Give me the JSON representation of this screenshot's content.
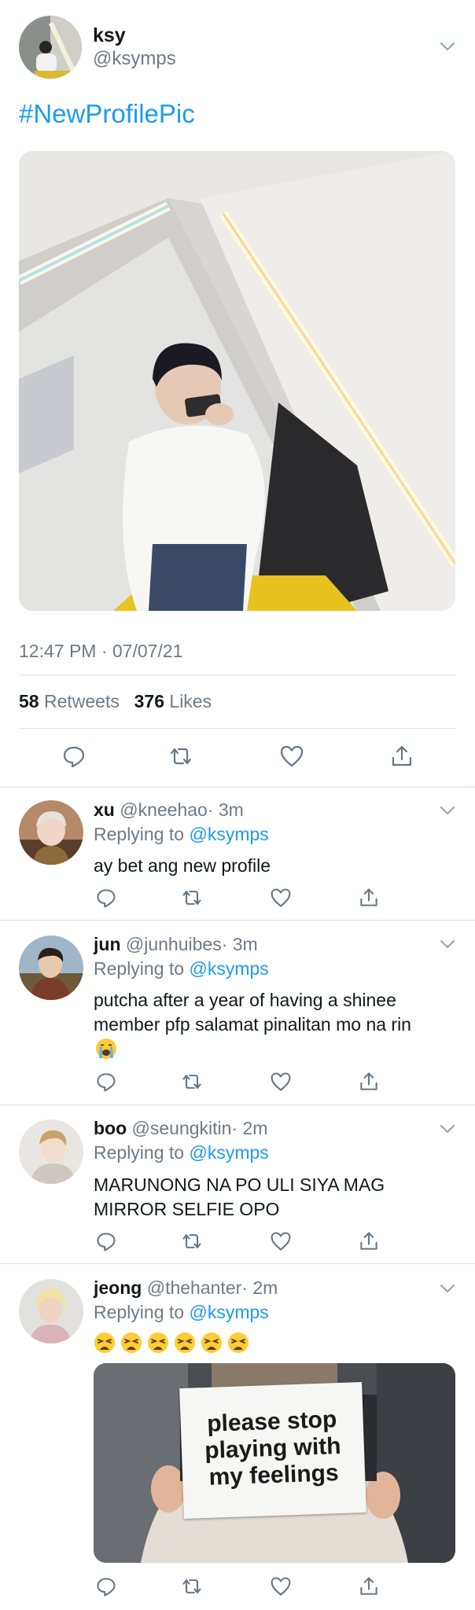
{
  "tweet": {
    "display_name": "ksy",
    "handle": "@ksymps",
    "text": "#NewProfilePic",
    "timestamp": "12:47 PM · 07/07/21",
    "retweets_count": "58",
    "retweets_label": "Retweets",
    "likes_count": "376",
    "likes_label": "Likes"
  },
  "replies": [
    {
      "name": "xu",
      "handle": "@kneehao",
      "time": "· 3m",
      "replying_prefix": "Replying to",
      "replying_to": "@ksymps",
      "text": "ay bet ang new profile"
    },
    {
      "name": "jun",
      "handle": "@junhuibes",
      "time": "· 3m",
      "replying_prefix": "Replying to",
      "replying_to": "@ksymps",
      "text_line1": "putcha after a year of having a shinee",
      "text_line2": "member pfp salamat pinalitan mo na rin",
      "emoji": "crying-face"
    },
    {
      "name": "boo",
      "handle": "@seungkitin",
      "time": "· 2m",
      "replying_prefix": "Replying to",
      "replying_to": "@ksymps",
      "text_line1": "MARUNONG NA PO ULI SIYA MAG",
      "text_line2": "MIRROR SELFIE OPO"
    },
    {
      "name": "jeong",
      "handle": "@thehanter",
      "time": "· 2m",
      "replying_prefix": "Replying to",
      "replying_to": "@ksymps",
      "emojis": [
        "weary-face",
        "weary-face",
        "weary-face",
        "weary-face",
        "weary-face",
        "weary-face"
      ],
      "meme_line1": "please stop",
      "meme_line2": "playing with",
      "meme_line3": "my feelings"
    }
  ],
  "colors": {
    "accent": "#1d9bf0",
    "secondary_text": "#6e7a85",
    "divider": "#dfe3e6"
  }
}
